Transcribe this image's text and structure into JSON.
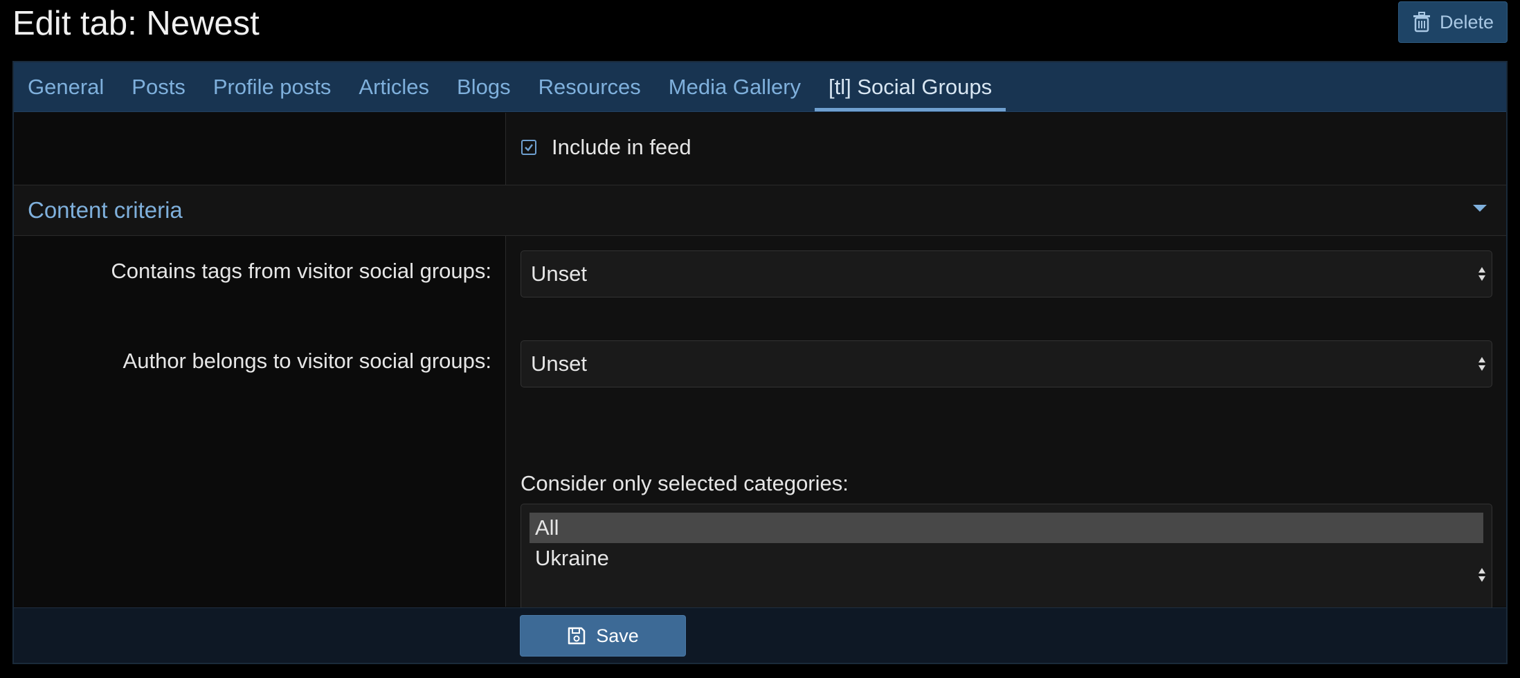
{
  "page": {
    "title": "Edit tab: Newest",
    "delete_label": "Delete",
    "save_label": "Save"
  },
  "tabs": [
    {
      "label": "General"
    },
    {
      "label": "Posts"
    },
    {
      "label": "Profile posts"
    },
    {
      "label": "Articles"
    },
    {
      "label": "Blogs"
    },
    {
      "label": "Resources"
    },
    {
      "label": "Media Gallery"
    },
    {
      "label": "[tl] Social Groups",
      "active": true
    }
  ],
  "feed": {
    "include_label": "Include in feed",
    "checked": true
  },
  "section": {
    "title": "Content criteria"
  },
  "fields": {
    "tags_label": "Contains tags from visitor social groups:",
    "tags_value": "Unset",
    "author_label": "Author belongs to visitor social groups:",
    "author_value": "Unset",
    "categories_label": "Consider only selected categories:",
    "categories": [
      "All",
      "Ukraine"
    ],
    "categories_selected": "All"
  },
  "icons": {
    "delete": "trash-icon",
    "save": "floppy-disk-icon",
    "check": "checkmark-icon",
    "collapse": "caret-down-icon",
    "select": "updown-arrows-icon"
  },
  "colors": {
    "accent": "#6fa0d0",
    "tab_bar": "#183451",
    "save_button": "#3d6a96",
    "delete_button": "#1e4466"
  }
}
